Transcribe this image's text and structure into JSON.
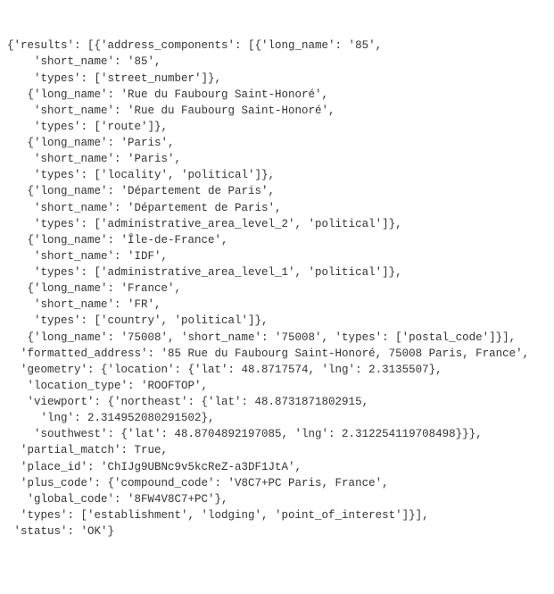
{
  "lines": [
    "{'results': [{'address_components': [{'long_name': '85',",
    "    'short_name': '85',",
    "    'types': ['street_number']},",
    "   {'long_name': 'Rue du Faubourg Saint-Honoré',",
    "    'short_name': 'Rue du Faubourg Saint-Honoré',",
    "    'types': ['route']},",
    "   {'long_name': 'Paris',",
    "    'short_name': 'Paris',",
    "    'types': ['locality', 'political']},",
    "   {'long_name': 'Département de Paris',",
    "    'short_name': 'Département de Paris',",
    "    'types': ['administrative_area_level_2', 'political']},",
    "   {'long_name': 'Île-de-France',",
    "    'short_name': 'IDF',",
    "    'types': ['administrative_area_level_1', 'political']},",
    "   {'long_name': 'France',",
    "    'short_name': 'FR',",
    "    'types': ['country', 'political']},",
    "   {'long_name': '75008', 'short_name': '75008', 'types': ['postal_code']}],",
    "  'formatted_address': '85 Rue du Faubourg Saint-Honoré, 75008 Paris, France',",
    "  'geometry': {'location': {'lat': 48.8717574, 'lng': 2.3135507},",
    "   'location_type': 'ROOFTOP',",
    "   'viewport': {'northeast': {'lat': 48.8731871802915,",
    "     'lng': 2.314952080291502},",
    "    'southwest': {'lat': 48.8704892197085, 'lng': 2.312254119708498}}},",
    "  'partial_match': True,",
    "  'place_id': 'ChIJg9UBNc9v5kcReZ-a3DF1JtA',",
    "  'plus_code': {'compound_code': 'V8C7+PC Paris, France',",
    "   'global_code': '8FW4V8C7+PC'},",
    "  'types': ['establishment', 'lodging', 'point_of_interest']}],",
    " 'status': 'OK'}"
  ]
}
